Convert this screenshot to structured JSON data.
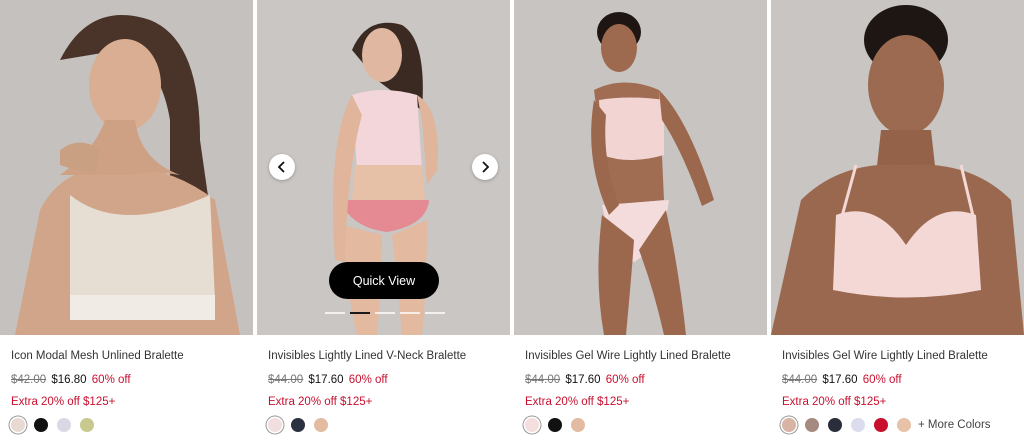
{
  "products": [
    {
      "name": "Icon Modal Mesh Unlined Bralette",
      "original_price": "$42.00",
      "sale_price": "$16.80",
      "discount": "60% off",
      "promo": "Extra 20% off $125+",
      "swatches": [
        "#e8d9d3",
        "#111111",
        "#d9d9e6",
        "#c8c98f"
      ],
      "selected_swatch": 0,
      "more_colors": ""
    },
    {
      "name": "Invisibles Lightly Lined V-Neck Bralette",
      "original_price": "$44.00",
      "sale_price": "$17.60",
      "discount": "60% off",
      "promo": "Extra 20% off $125+",
      "swatches": [
        "#f1dfe0",
        "#2a3140",
        "#e3bba0"
      ],
      "selected_swatch": 0,
      "more_colors": "",
      "carousel": {
        "quick_view_label": "Quick View",
        "prev_icon": "chevron-left-icon",
        "next_icon": "chevron-right-icon",
        "slides": 5,
        "active_slide": 1
      }
    },
    {
      "name": "Invisibles Gel Wire Lightly Lined Bralette",
      "original_price": "$44.00",
      "sale_price": "$17.60",
      "discount": "60% off",
      "promo": "Extra 20% off $125+",
      "swatches": [
        "#f6dede",
        "#111111",
        "#e3bba0"
      ],
      "selected_swatch": 0,
      "more_colors": ""
    },
    {
      "name": "Invisibles Gel Wire Lightly Lined Bralette",
      "original_price": "$44.00",
      "sale_price": "$17.60",
      "discount": "60% off",
      "promo": "Extra 20% off $125+",
      "swatches": [
        "#d9b3a4",
        "#a58a80",
        "#2a2d3a",
        "#dcdcef",
        "#c8102e",
        "#e8c2a8"
      ],
      "selected_swatch": 0,
      "more_colors": "+ More Colors"
    }
  ],
  "colors": {
    "sale_red": "#c8102e",
    "photo_bg": "#c9c6c3"
  }
}
